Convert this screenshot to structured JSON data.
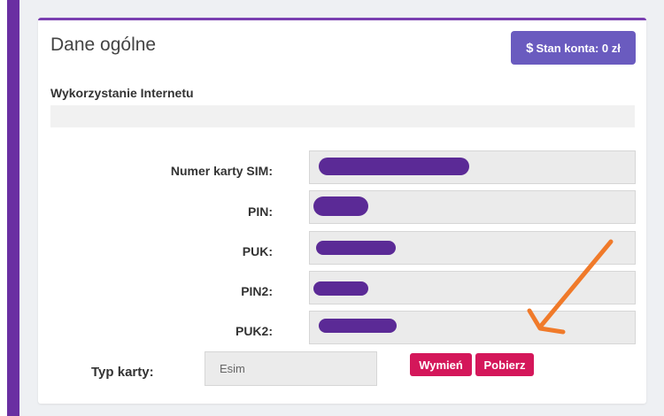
{
  "card": {
    "title": "Dane ogólne",
    "balance_button": {
      "icon": "$",
      "label": "Stan konta: 0 zł"
    },
    "section_title": "Wykorzystanie Internetu"
  },
  "sim_fields": [
    {
      "label": "Numer karty SIM:",
      "value_redacted": true
    },
    {
      "label": "PIN:",
      "value_redacted": true
    },
    {
      "label": "PUK:",
      "value_redacted": true
    },
    {
      "label": "PIN2:",
      "value_redacted": true
    },
    {
      "label": "PUK2:",
      "value_redacted": true
    }
  ],
  "card_type": {
    "label": "Typ karty:",
    "value": "Esim",
    "buttons": {
      "replace": "Wymień",
      "download": "Pobierz"
    }
  },
  "colors": {
    "accent_purple": "#6a2fa2",
    "button_purple": "#6a5bbf",
    "redaction": "#5b2a96",
    "button_pink": "#d4175a",
    "annotation_arrow": "#f07a2a"
  },
  "annotation": {
    "icon": "arrow-annotation-icon",
    "color": "#f07a2a"
  }
}
